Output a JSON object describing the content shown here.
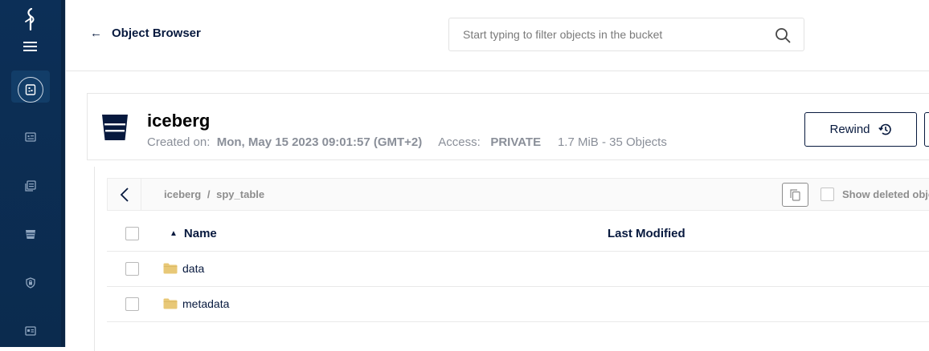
{
  "sidebar": {
    "items": [
      {
        "icon": "object-browser-icon",
        "active": true
      },
      {
        "icon": "monitoring-icon",
        "active": false
      },
      {
        "icon": "documentation-icon",
        "active": false
      },
      {
        "icon": "buckets-icon",
        "active": false
      },
      {
        "icon": "access-keys-icon",
        "active": false
      },
      {
        "icon": "license-icon",
        "active": false
      }
    ]
  },
  "header": {
    "back_arrow": "←",
    "title": "Object Browser",
    "search_placeholder": "Start typing to filter objects in the bucket"
  },
  "bucket": {
    "name": "iceberg",
    "created_label": "Created on:",
    "created_value": "Mon, May 15 2023 09:01:57 (GMT+2)",
    "access_label": "Access:",
    "access_value": "PRIVATE",
    "summary": "1.7 MiB - 35 Objects",
    "rewind_label": "Rewind"
  },
  "browser": {
    "breadcrumb_root": "iceberg",
    "breadcrumb_sep": "/",
    "breadcrumb_current": "spy_table",
    "show_deleted_label": "Show deleted objects",
    "columns": {
      "name": "Name",
      "last_modified": "Last Modified"
    },
    "rows": [
      {
        "name": "data",
        "type": "folder",
        "last_modified": ""
      },
      {
        "name": "metadata",
        "type": "folder",
        "last_modified": ""
      }
    ]
  },
  "colors": {
    "sidebar": "#0c2f57",
    "text_primary": "#07193e",
    "text_muted": "#8a8f99",
    "folder": "#e8c877"
  }
}
